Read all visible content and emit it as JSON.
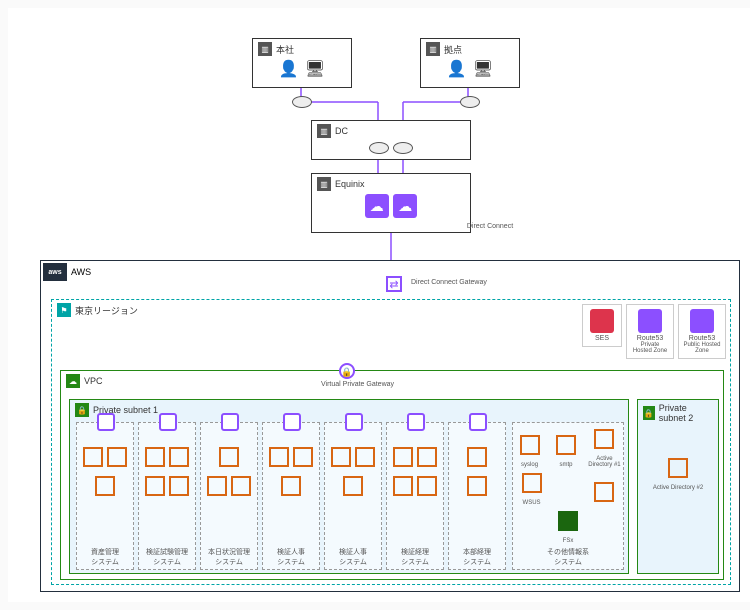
{
  "top": {
    "hq": "本社",
    "branch": "拠点",
    "dc": "DC",
    "equinix": "Equinix",
    "dx": "Direct Connect"
  },
  "gw": {
    "dxgw": "Direct Connect Gateway",
    "vgw": "Virtual Private Gateway"
  },
  "aws": {
    "label": "AWS",
    "region": "東京リージョン",
    "vpc": "VPC"
  },
  "svc": {
    "ses": "SES",
    "r53a": "Route53",
    "r53a_sub": "Private Hosted Zone",
    "r53b": "Route53",
    "r53b_sub": "Public Hosted Zone"
  },
  "subnet": {
    "p1": "Private subnet 1",
    "p2": "Private subnet 2"
  },
  "sys": {
    "s1": "資産管理\nシステム",
    "s2": "検証試験管理\nシステム",
    "s3": "本日状況管理\nシステム",
    "s4": "検証人事\nシステム",
    "s5": "検証人事\nシステム",
    "s6": "検証経理\nシステム",
    "s7": "本部経理\nシステム",
    "infra": "その他情報系\nシステム"
  },
  "infra": {
    "syslog": "syslog",
    "smtp": "smtp",
    "ad1": "Active Directory #1",
    "wsus": "WSUS",
    "fsx": "FSx",
    "ad2": "Active Directory #2"
  }
}
